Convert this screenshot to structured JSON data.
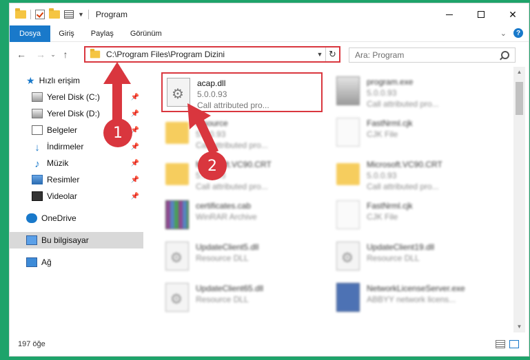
{
  "window": {
    "title": "Program"
  },
  "ribbon": {
    "tabs": [
      {
        "label": "Dosya"
      },
      {
        "label": "Giriş"
      },
      {
        "label": "Paylaş"
      },
      {
        "label": "Görünüm"
      }
    ]
  },
  "address_bar": {
    "path": "C:\\Program Files\\Program Dizini"
  },
  "search": {
    "placeholder": "Ara: Program"
  },
  "navigation": {
    "quick_access": "Hızlı erişim",
    "items": [
      {
        "label": "Yerel Disk (C:)",
        "icon": "drive-icon"
      },
      {
        "label": "Yerel Disk (D:)",
        "icon": "drive-icon"
      },
      {
        "label": "Belgeler",
        "icon": "documents-icon"
      },
      {
        "label": "İndirmeler",
        "icon": "download-icon"
      },
      {
        "label": "Müzik",
        "icon": "music-icon"
      },
      {
        "label": "Resimler",
        "icon": "pictures-icon"
      },
      {
        "label": "Videolar",
        "icon": "videos-icon"
      }
    ],
    "onedrive": "OneDrive",
    "this_pc": "Bu bilgisayar",
    "network": "Ağ"
  },
  "files": [
    {
      "name": "acap.dll",
      "line2": "5.0.0.93",
      "line3": "Call attributed pro...",
      "icon": "dll-icon",
      "highlighted": true
    },
    {
      "name": "program.exe",
      "line2": "5.0.0.93",
      "line3": "Call attributed pro...",
      "icon": "exe-icon"
    },
    {
      "name": "resource",
      "line2": "5.0.0.93",
      "line3": "Call attributed pro...",
      "icon": "folder-icon"
    },
    {
      "name": "FastNrml.cjk",
      "line2": "CJK File",
      "line3": "",
      "icon": "file-icon"
    },
    {
      "name": "Microsoft.VC90.CRT",
      "line2": "5.0.0.93",
      "line3": "Call attributed pro...",
      "icon": "folder-icon"
    },
    {
      "name": "Microsoft.VC90.CRT",
      "line2": "5.0.0.93",
      "line3": "Call attributed pro...",
      "icon": "folder-icon"
    },
    {
      "name": "certificates.cab",
      "line2": "WinRAR Archive",
      "line3": "",
      "icon": "archive-icon"
    },
    {
      "name": "FastNrml.cjk",
      "line2": "CJK File",
      "line3": "",
      "icon": "file-icon"
    },
    {
      "name": "UpdateClient5.dll",
      "line2": "Resource DLL",
      "line3": "",
      "icon": "dll-icon"
    },
    {
      "name": "UpdateClient19.dll",
      "line2": "Resource DLL",
      "line3": "",
      "icon": "dll-icon"
    },
    {
      "name": "UpdateClient65.dll",
      "line2": "Resource DLL",
      "line3": "",
      "icon": "dll-icon"
    },
    {
      "name": "NetworkLicenseServer.exe",
      "line2": "ABBYY network licens...",
      "line3": "",
      "icon": "exe-icon"
    }
  ],
  "status": {
    "item_count": "197 öğe"
  },
  "annotations": {
    "step1": "1",
    "step2": "2",
    "color": "#d9363e"
  },
  "colors": {
    "accent": "#1979ca",
    "background": "#1ea36a"
  }
}
